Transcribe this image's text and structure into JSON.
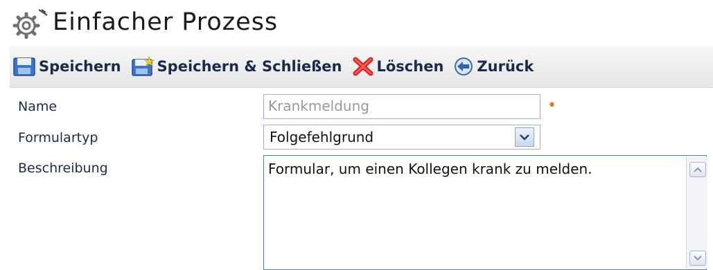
{
  "header": {
    "title": "Einfacher Prozess",
    "icon": "gear-icon"
  },
  "toolbar": {
    "save_label": "Speichern",
    "save_close_label": "Speichern & Schließen",
    "delete_label": "Löschen",
    "back_label": "Zurück"
  },
  "form": {
    "name_label": "Name",
    "name_value": "Krankmeldung",
    "required_marker": "•",
    "type_label": "Formulartyp",
    "type_value": "Folgefehlgrund",
    "description_label": "Beschreibung",
    "description_value": "Formular, um einen Kollegen krank zu melden."
  },
  "colors": {
    "label_text": "#1a2a4a",
    "required": "#e07a1e",
    "delete_icon": "#d42020",
    "field_border": "#9fb0c8"
  }
}
